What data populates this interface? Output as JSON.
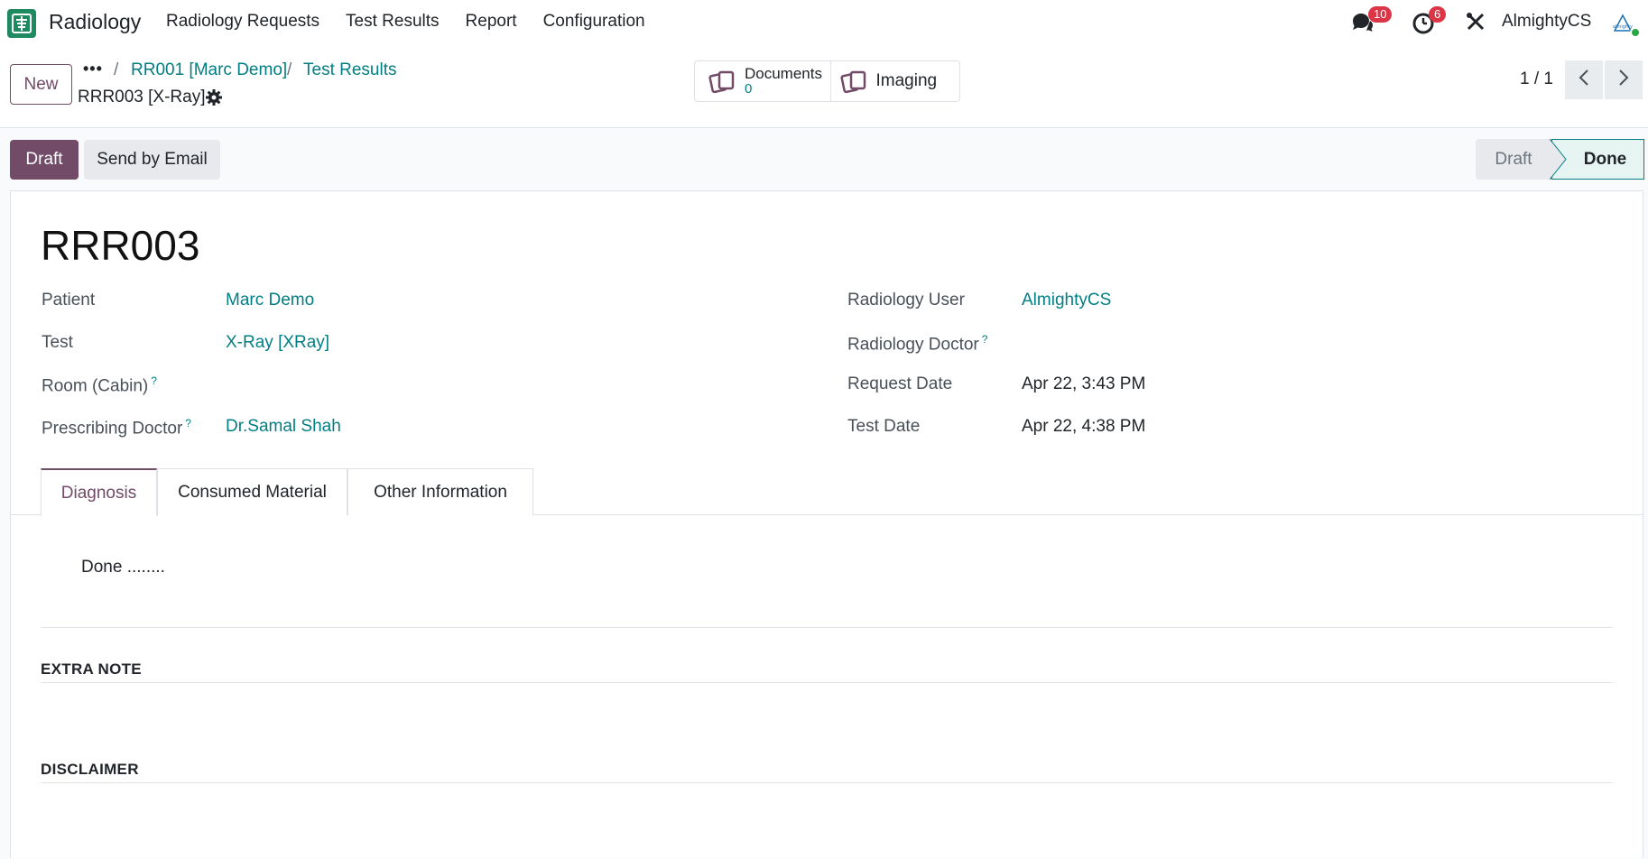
{
  "navbar": {
    "app_name": "Radiology",
    "menu": [
      "Radiology Requests",
      "Test Results",
      "Report",
      "Configuration"
    ],
    "messages_badge": "10",
    "activities_badge": "6",
    "user": "AlmightyCS",
    "avatar_text": "almighty"
  },
  "breadcrumb": {
    "new_label": "New",
    "more": "•••",
    "sep": "/",
    "items": [
      "RR001 [Marc Demo]",
      "Test Results"
    ],
    "current": "RRR003 [X-Ray]"
  },
  "smart_buttons": {
    "documents_label": "Documents",
    "documents_count": "0",
    "imaging_label": "Imaging"
  },
  "pager": {
    "text": "1 / 1"
  },
  "statusbar": {
    "draft_button": "Draft",
    "email_button": "Send by Email",
    "stages": [
      "Draft",
      "Done"
    ],
    "current_stage": "Done"
  },
  "record": {
    "name": "RRR003",
    "left_fields": [
      {
        "label": "Patient",
        "value": "Marc Demo",
        "help": ""
      },
      {
        "label": "Test",
        "value": "X-Ray [XRay]",
        "help": ""
      },
      {
        "label": "Room (Cabin)",
        "value": "",
        "help": "?"
      },
      {
        "label": "Prescribing Doctor",
        "value": "Dr.Samal Shah",
        "help": "?"
      }
    ],
    "right_fields": [
      {
        "label": "Radiology User",
        "value": "AlmightyCS",
        "help": ""
      },
      {
        "label": "Radiology Doctor",
        "value": "",
        "help": "?"
      },
      {
        "label": "Request Date",
        "value": "Apr 22, 3:43 PM",
        "help": ""
      },
      {
        "label": "Test Date",
        "value": "Apr 22, 4:38 PM",
        "help": ""
      }
    ]
  },
  "tabs": [
    "Diagnosis",
    "Consumed Material",
    "Other Information"
  ],
  "diagnosis_text": "Done ........",
  "sections": {
    "extra_note": "EXTRA NOTE",
    "disclaimer": "DISCLAIMER"
  },
  "colors": {
    "brand": "#714b67",
    "link": "#017e84",
    "app_icon": "#1f8a5f",
    "badge": "#dc3545"
  }
}
